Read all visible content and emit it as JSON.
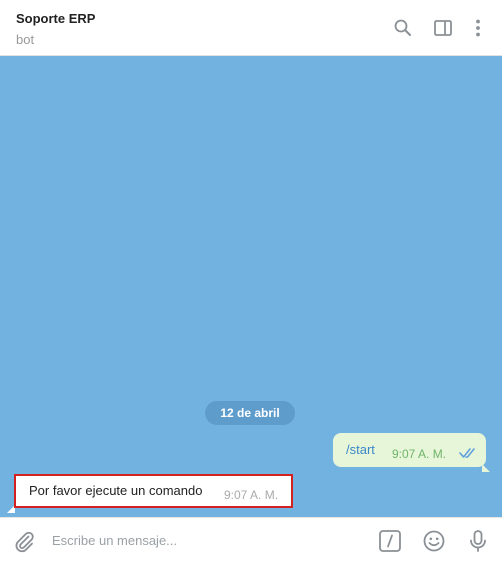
{
  "header": {
    "title": "Soporte ERP",
    "subtitle": "bot",
    "icons": [
      "search-icon",
      "sidebar-toggle-icon",
      "more-vertical-icon"
    ]
  },
  "chat": {
    "background_color": "#72b2e0",
    "date_label": "12 de abril",
    "messages": [
      {
        "direction": "outgoing",
        "text": "/start",
        "time": "9:07 A. M.",
        "status": "read"
      },
      {
        "direction": "incoming",
        "text": "Por favor ejecute un comando",
        "time": "9:07 A. M."
      }
    ]
  },
  "composer": {
    "placeholder": "Escribe un mensaje...",
    "icons": [
      "attach-icon",
      "bot-command-icon",
      "emoji-icon",
      "microphone-icon"
    ]
  }
}
